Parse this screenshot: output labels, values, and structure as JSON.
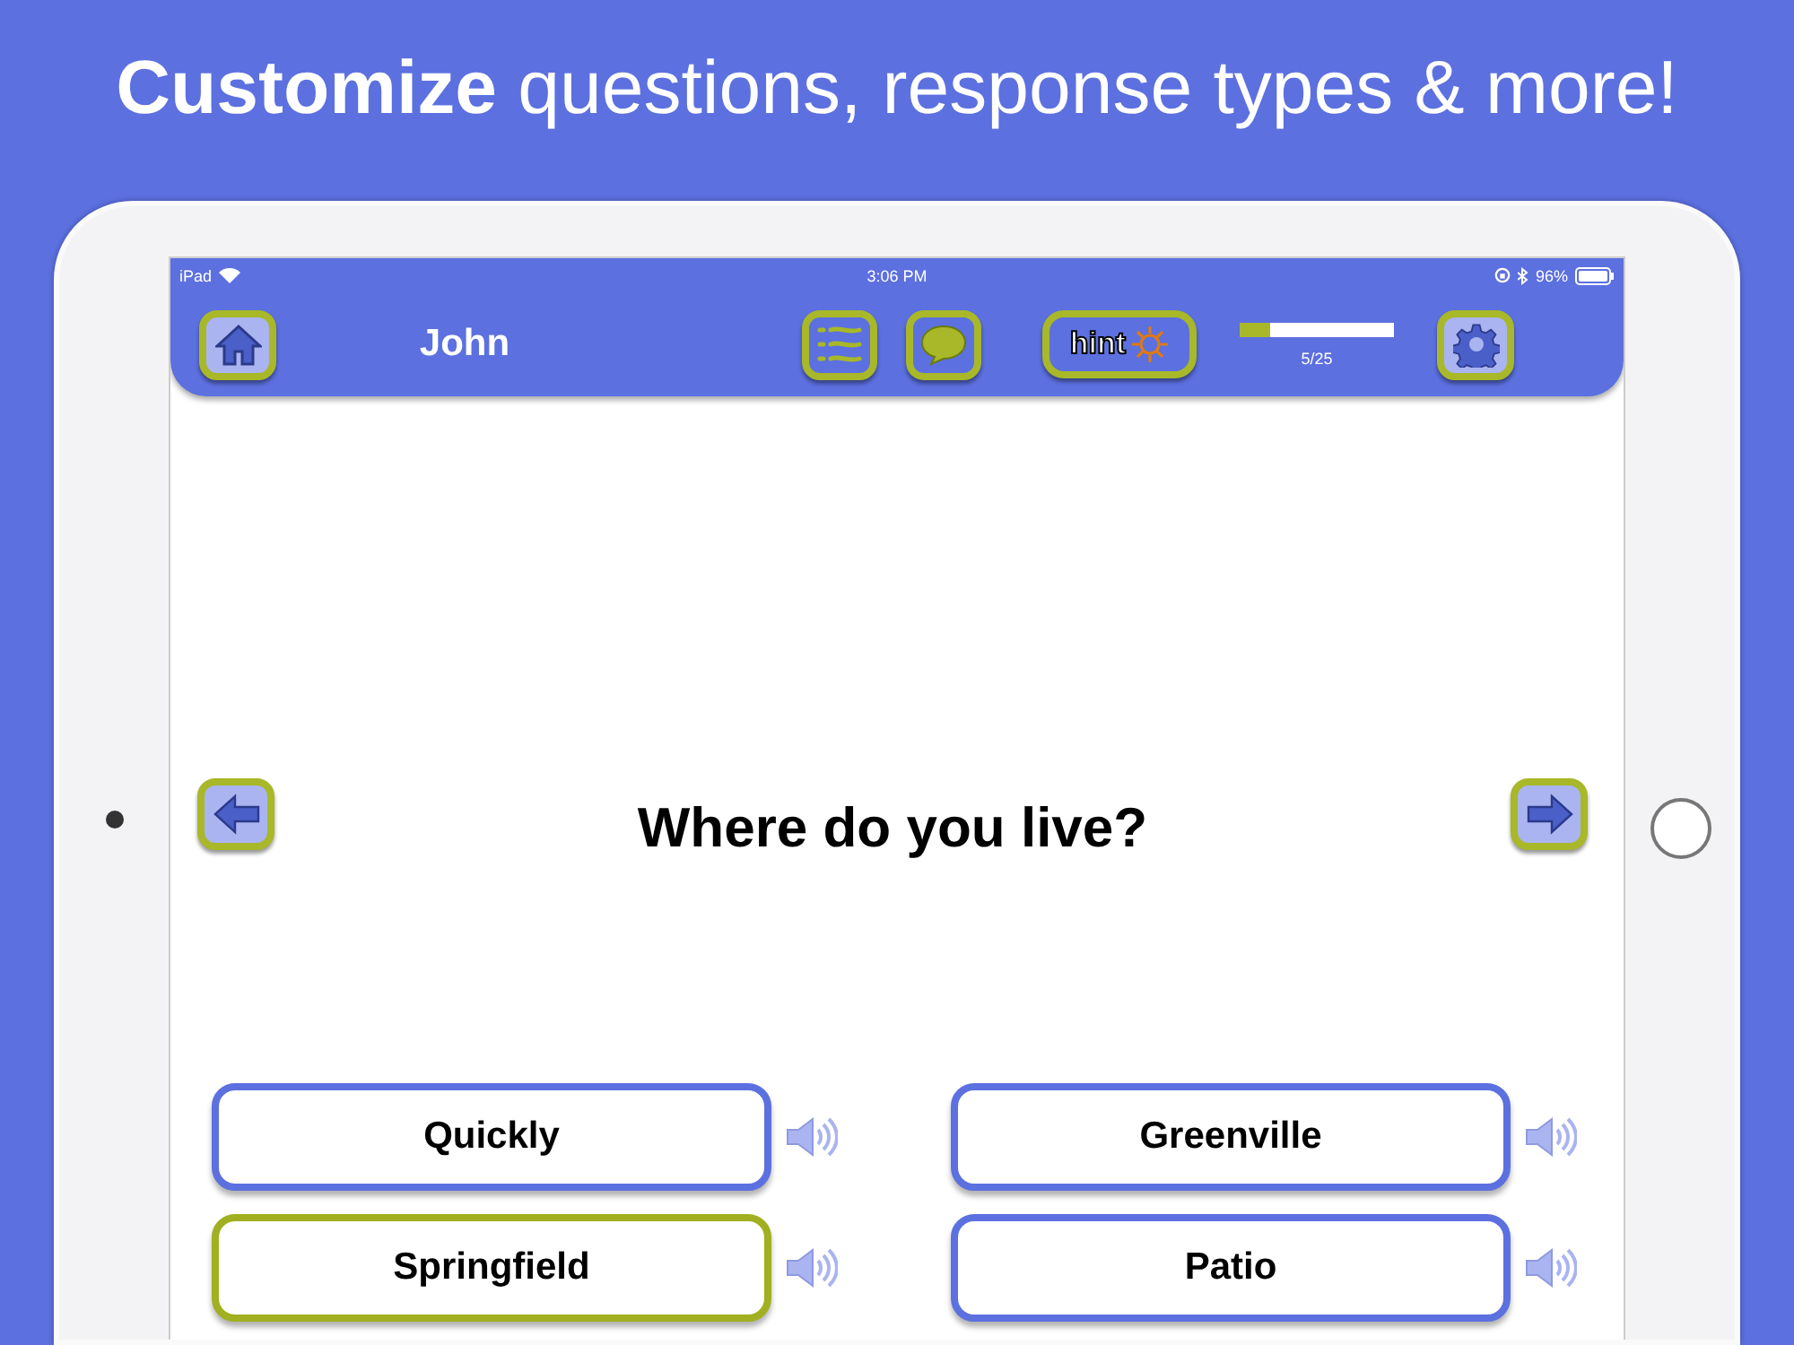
{
  "headline": "**Customize** questions, response types & more!",
  "status_bar": {
    "carrier": "iPad",
    "time": "3:06 PM",
    "battery": "96%"
  },
  "header": {
    "student": "John",
    "hint_button": "hint",
    "progress": {
      "level": 0.2,
      "reading": "5/25"
    }
  },
  "question": "Where do you live?",
  "answers": [
    {
      "label": "Quickly",
      "selected": false
    },
    {
      "label": "Greenville",
      "selected": false
    },
    {
      "label": "Springfield",
      "selected": true
    },
    {
      "label": "Patio",
      "selected": false
    }
  ]
}
